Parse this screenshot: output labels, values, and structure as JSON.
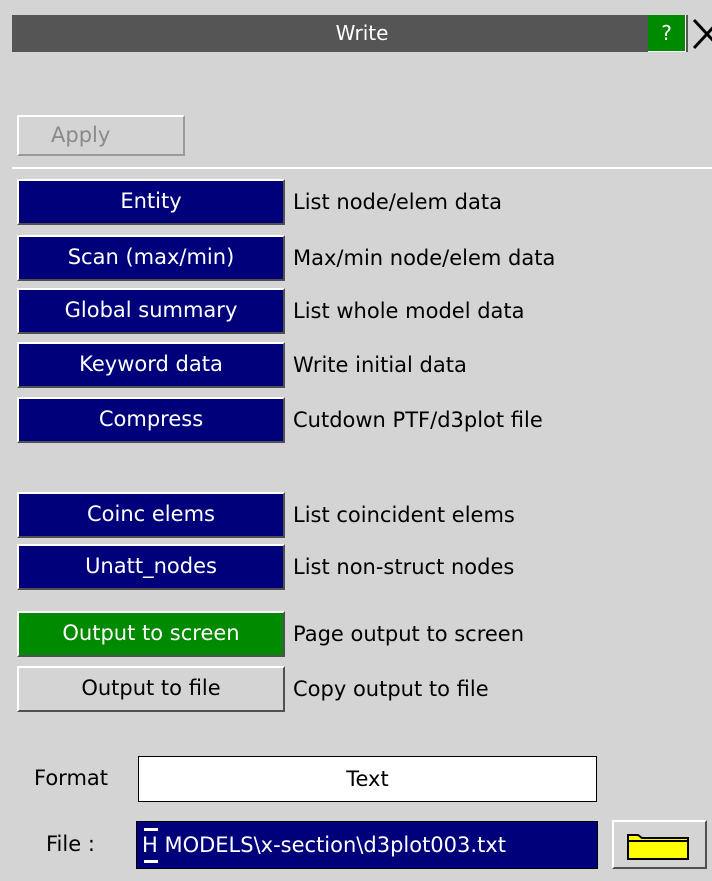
{
  "window": {
    "title": "Write",
    "help": "?"
  },
  "apply_label": "Apply",
  "rows": [
    {
      "button": "Entity",
      "desc": "List node/elem data"
    },
    {
      "button": "Scan (max/min)",
      "desc": "Max/min node/elem data"
    },
    {
      "button": "Global summary",
      "desc": "List whole model data"
    },
    {
      "button": "Keyword data",
      "desc": "Write initial data"
    },
    {
      "button": "Compress",
      "desc": "Cutdown PTF/d3plot file"
    },
    {
      "button": "Coinc elems",
      "desc": "List coincident elems"
    },
    {
      "button": "Unatt_nodes",
      "desc": "List non-struct nodes"
    }
  ],
  "output": {
    "screen": {
      "button": "Output to screen",
      "desc": "Page output to screen",
      "color": "#008a00"
    },
    "file": {
      "button": "Output to file",
      "desc": "Copy output to file"
    }
  },
  "format": {
    "label": "Format",
    "value": "Text"
  },
  "file": {
    "label": "File :",
    "value": "H MODELS\\x-section\\d3plot003.txt"
  },
  "icons": {
    "help": "help-icon",
    "close": "close-icon",
    "dropdown": "dropdown-arrow-icon",
    "folder": "folder-icon"
  }
}
